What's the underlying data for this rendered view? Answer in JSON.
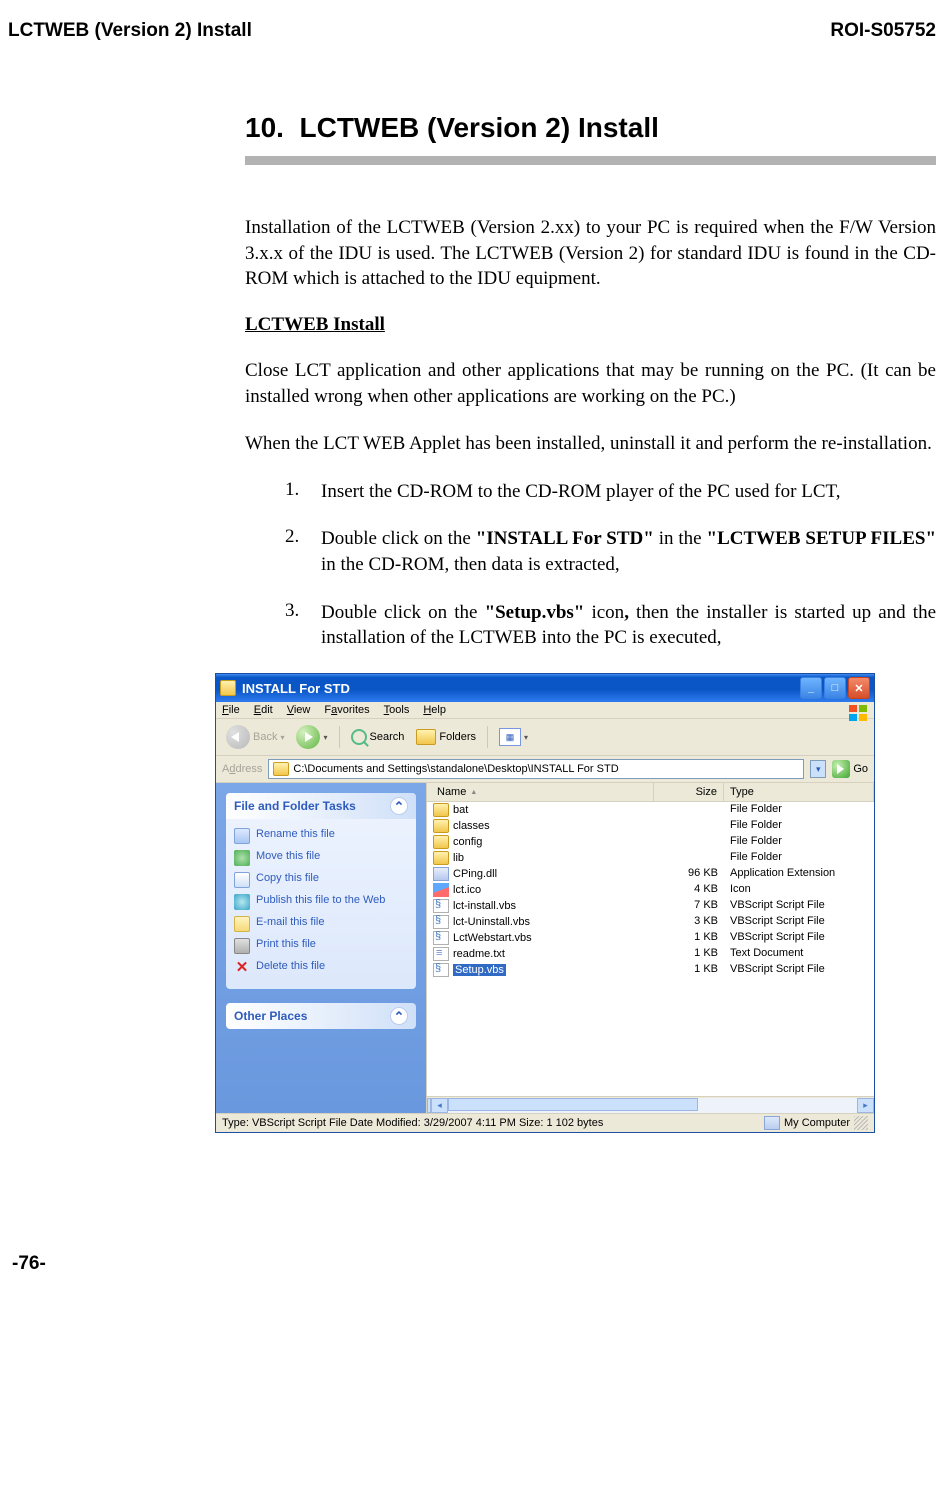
{
  "page_header": {
    "left": "LCTWEB (Version 2) Install",
    "right": "ROI-S05752"
  },
  "page_footer": "-76-",
  "section": {
    "number": "10.",
    "title": "LCTWEB (Version 2) Install"
  },
  "paragraphs": {
    "p1": "Installation of the LCTWEB (Version 2.xx) to your PC is required when the F/W Version 3.x.x of the IDU is used.  The LCTWEB (Version 2) for standard IDU is found in the CD-ROM which is attached to the IDU equipment.",
    "subhead": "LCTWEB Install",
    "p2": "Close LCT application and other applications that may be running on the PC. (It can be installed wrong when other applications are working on the PC.)",
    "p3": "When the LCT WEB Applet has been installed, uninstall it and perform the re-installation."
  },
  "list": {
    "i1": {
      "num": "1.",
      "text": "Insert the CD-ROM to the CD-ROM player of the PC used for LCT,"
    },
    "i2": {
      "num": "2.",
      "pre": "Double click on the ",
      "b1": "\"INSTALL For STD\"",
      "mid": " in the ",
      "b2": "\"LCTWEB SETUP FILES\"",
      "post": " in the CD-ROM, then data is extracted,"
    },
    "i3": {
      "num": "3.",
      "pre": "Double click on the ",
      "b1": "\"Setup.vbs\"",
      "mid": " icon",
      "b2": ",",
      "post": " then the installer is started up and the installation of the LCTWEB into the PC is executed,"
    }
  },
  "explorer": {
    "title": "INSTALL For STD",
    "menubar": [
      "File",
      "Edit",
      "View",
      "Favorites",
      "Tools",
      "Help"
    ],
    "toolbar": {
      "back": "Back",
      "search": "Search",
      "folders": "Folders"
    },
    "address": {
      "label": "Address",
      "path": "C:\\Documents and Settings\\standalone\\Desktop\\INSTALL For STD",
      "go": "Go"
    },
    "tasks_head": "File and Folder Tasks",
    "tasks": [
      "Rename this file",
      "Move this file",
      "Copy this file",
      "Publish this file to the Web",
      "E-mail this file",
      "Print this file",
      "Delete this file"
    ],
    "other_head": "Other Places",
    "columns": {
      "name": "Name",
      "size": "Size",
      "type": "Type"
    },
    "files": [
      {
        "name": "bat",
        "size": "",
        "type": "File Folder",
        "icon": "folder"
      },
      {
        "name": "classes",
        "size": "",
        "type": "File Folder",
        "icon": "folder"
      },
      {
        "name": "config",
        "size": "",
        "type": "File Folder",
        "icon": "folder"
      },
      {
        "name": "lib",
        "size": "",
        "type": "File Folder",
        "icon": "folder"
      },
      {
        "name": "CPing.dll",
        "size": "96 KB",
        "type": "Application Extension",
        "icon": "dll"
      },
      {
        "name": "lct.ico",
        "size": "4 KB",
        "type": "Icon",
        "icon": "ico"
      },
      {
        "name": "lct-install.vbs",
        "size": "7 KB",
        "type": "VBScript Script File",
        "icon": "vbs"
      },
      {
        "name": "lct-Uninstall.vbs",
        "size": "3 KB",
        "type": "VBScript Script File",
        "icon": "vbs"
      },
      {
        "name": "LctWebstart.vbs",
        "size": "1 KB",
        "type": "VBScript Script File",
        "icon": "vbs"
      },
      {
        "name": "readme.txt",
        "size": "1 KB",
        "type": "Text Document",
        "icon": "txt"
      },
      {
        "name": "Setup.vbs",
        "size": "1 KB",
        "type": "VBScript Script File",
        "icon": "vbs",
        "selected": true
      }
    ],
    "status": {
      "left": "Type: VBScript Script File Date Modified: 3/29/2007 4:11 PM Size: 1 102 bytes",
      "right": "My Computer"
    }
  }
}
